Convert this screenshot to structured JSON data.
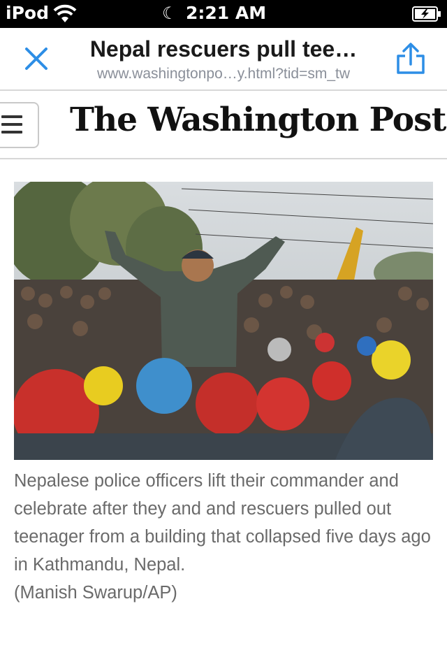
{
  "status_bar": {
    "carrier": "iPod",
    "time": "2:21 AM"
  },
  "nav": {
    "title": "Nepal rescuers pull tee…",
    "url": "www.washingtonpo…y.html?tid=sm_tw",
    "close_icon": "close-icon",
    "share_icon": "share-icon"
  },
  "masthead": {
    "logo_text": "The Washington Post",
    "menu_icon": "hamburger-menu-icon"
  },
  "article": {
    "caption": "Nepalese police officers lift their commander and celebrate after they and and rescuers pulled out teenager from a building that collapsed five days ago in Kathmandu, Nepal.",
    "credit": "(Manish Swarup/AP)"
  },
  "colors": {
    "accent": "#2d8ee6",
    "status_bar_bg": "#000000",
    "caption_text": "#6a6a6a",
    "url_text": "#8a8f99"
  }
}
